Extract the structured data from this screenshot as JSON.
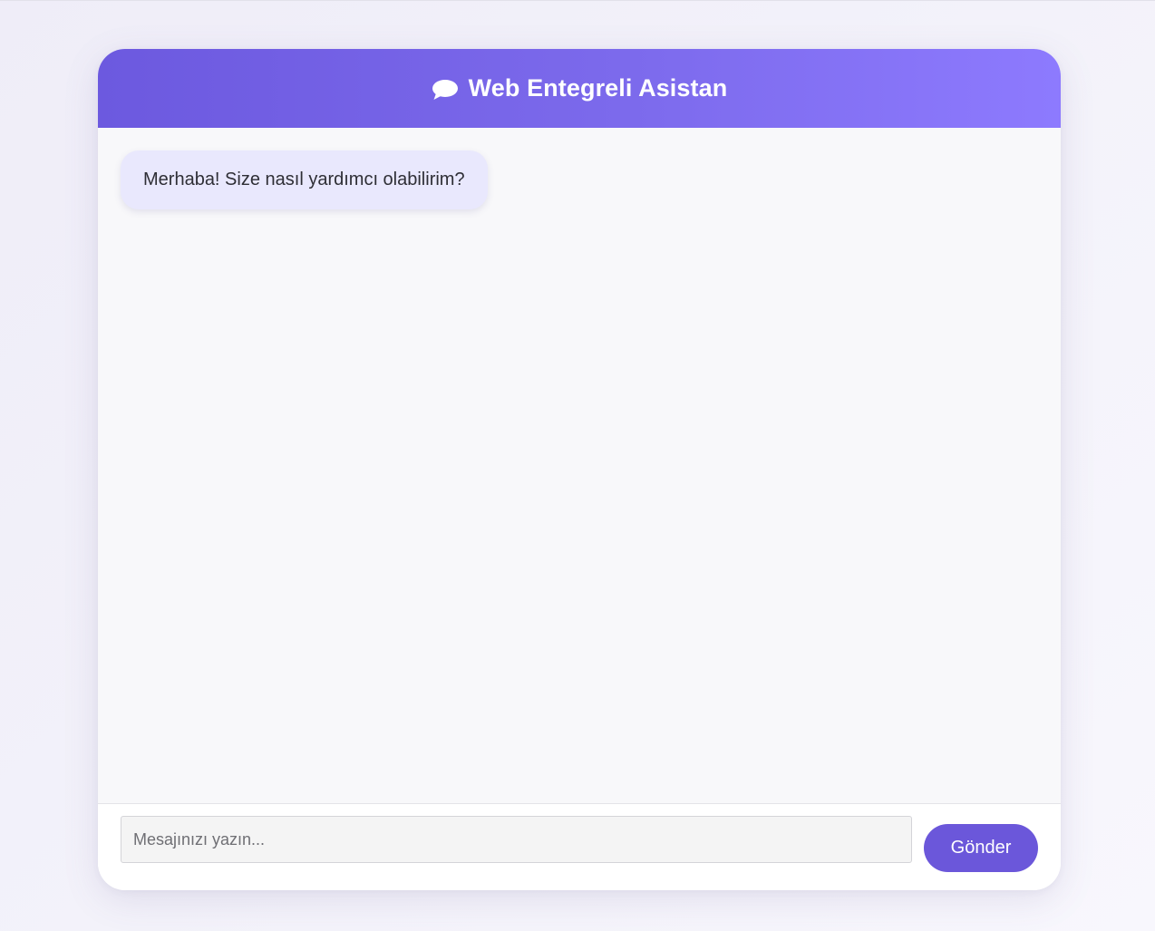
{
  "header": {
    "icon": "speech-bubble-icon",
    "title": "Web Entegreli Asistan"
  },
  "messages": [
    {
      "sender": "bot",
      "text": "Merhaba! Size nasıl yardımcı olabilirim?"
    }
  ],
  "input": {
    "placeholder": "Mesajınızı yazın...",
    "value": ""
  },
  "send_button": {
    "label": "Gönder"
  },
  "colors": {
    "header_gradient_start": "#6c59df",
    "header_gradient_end": "#8d7afe",
    "accent": "#6b57da",
    "bot_bubble": "#e9e8fd",
    "messages_background": "#f8f8fa"
  }
}
